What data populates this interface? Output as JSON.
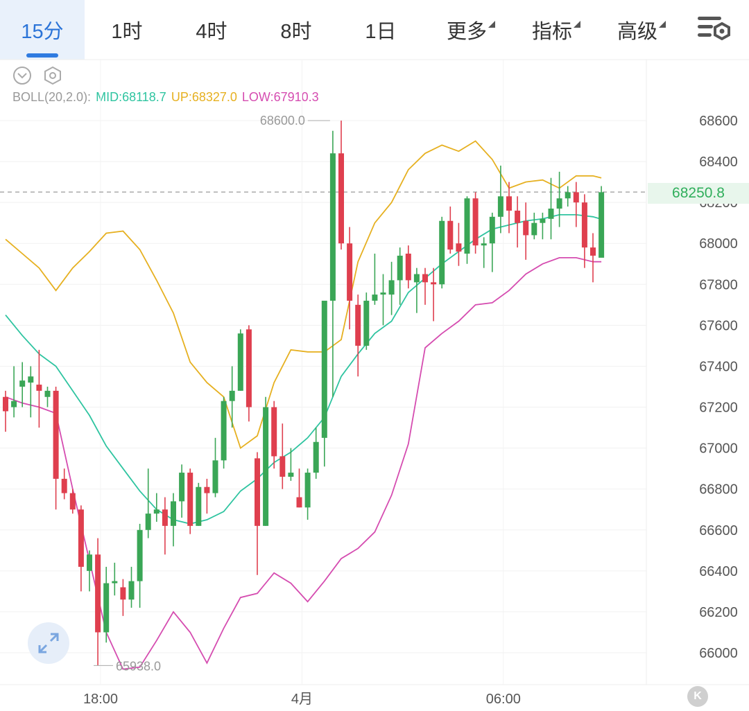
{
  "tabs": [
    {
      "label": "15分",
      "active": true
    },
    {
      "label": "1时"
    },
    {
      "label": "4时"
    },
    {
      "label": "8时"
    },
    {
      "label": "1日"
    },
    {
      "label": "更多",
      "dropdown": true
    },
    {
      "label": "指标",
      "dropdown": true
    },
    {
      "label": "高级",
      "dropdown": true
    }
  ],
  "icons": {
    "collapse": "chevron-down-circle-icon",
    "settings": "hexagon-settings-icon",
    "toolbar_settings": "lines-gear-icon",
    "expand": "expand-arrows-icon"
  },
  "indicator": {
    "name": "BOLL(20,2.0):",
    "mid": "MID:68118.7",
    "up": "UP:68327.0",
    "low": "LOW:67910.3",
    "colors": {
      "mid": "#2ec4a0",
      "up": "#e6b020",
      "low": "#d54cb0"
    }
  },
  "colors": {
    "up_candle": "#3aa656",
    "down_candle": "#df3f4e",
    "accent": "#2b74d8"
  },
  "price_tag": "68250.8",
  "k_button": "K",
  "chart_data": {
    "type": "candlestick",
    "y_ticks": [
      "68600",
      "68400",
      "68200",
      "68000",
      "67800",
      "67600",
      "67400",
      "67200",
      "67000",
      "66800",
      "66600",
      "66400",
      "66200",
      "66000"
    ],
    "ylim": [
      65870,
      68720
    ],
    "x_ticks": [
      {
        "label": "18:00",
        "i": 10
      },
      {
        "label": "4月",
        "i": 34
      },
      {
        "label": "06:00",
        "i": 58
      }
    ],
    "grid": true,
    "current_price": 68250.8,
    "high_label": {
      "text": "68600.0",
      "value": 68600,
      "i": 39
    },
    "low_label": {
      "text": "65938.0",
      "value": 65938,
      "i": 10
    },
    "candles": [
      [
        67250,
        67280,
        67080,
        67180
      ],
      [
        67200,
        67400,
        67150,
        67230
      ],
      [
        67300,
        67420,
        67200,
        67330
      ],
      [
        67320,
        67400,
        67150,
        67350
      ],
      [
        67310,
        67480,
        67100,
        67280
      ],
      [
        67250,
        67300,
        67200,
        67280
      ],
      [
        67280,
        67300,
        66700,
        66850
      ],
      [
        66850,
        66900,
        66750,
        66780
      ],
      [
        66780,
        66800,
        66680,
        66700
      ],
      [
        66700,
        66720,
        66300,
        66420
      ],
      [
        66400,
        66500,
        66300,
        66480
      ],
      [
        66480,
        66560,
        65938,
        66100
      ],
      [
        66100,
        66420,
        66050,
        66340
      ],
      [
        66340,
        66440,
        66280,
        66350
      ],
      [
        66320,
        66360,
        66180,
        66260
      ],
      [
        66260,
        66420,
        66220,
        66350
      ],
      [
        66350,
        66630,
        66220,
        66600
      ],
      [
        66600,
        66900,
        66560,
        66680
      ],
      [
        66680,
        66780,
        66640,
        66700
      ],
      [
        66700,
        66760,
        66480,
        66620
      ],
      [
        66620,
        66780,
        66520,
        66740
      ],
      [
        66740,
        66920,
        66660,
        66880
      ],
      [
        66880,
        66900,
        66580,
        66620
      ],
      [
        66620,
        66830,
        66620,
        66810
      ],
      [
        66810,
        66850,
        66680,
        66780
      ],
      [
        66780,
        67050,
        66760,
        66940
      ],
      [
        66940,
        67250,
        66900,
        67230
      ],
      [
        67230,
        67400,
        67100,
        67280
      ],
      [
        67280,
        67580,
        67280,
        67560
      ],
      [
        67580,
        67600,
        67130,
        67200
      ],
      [
        66950,
        66980,
        66380,
        66620
      ],
      [
        66620,
        67250,
        66620,
        67200
      ],
      [
        67200,
        67230,
        66900,
        66960
      ],
      [
        66960,
        67120,
        66800,
        66860
      ],
      [
        66860,
        67000,
        66840,
        66880
      ],
      [
        66760,
        66900,
        66710,
        66710
      ],
      [
        66710,
        66900,
        66650,
        66880
      ],
      [
        66880,
        67100,
        66850,
        67030
      ],
      [
        67050,
        67620,
        66910,
        67720
      ],
      [
        67720,
        68550,
        67250,
        68440
      ],
      [
        68440,
        68600,
        67970,
        68000
      ],
      [
        68000,
        68080,
        67580,
        67720
      ],
      [
        67700,
        67750,
        67350,
        67500
      ],
      [
        67500,
        67760,
        67480,
        67720
      ],
      [
        67720,
        67950,
        67700,
        67750
      ],
      [
        67750,
        67850,
        67600,
        67760
      ],
      [
        67750,
        67910,
        67650,
        67820
      ],
      [
        67820,
        67980,
        67700,
        67940
      ],
      [
        67950,
        67990,
        67780,
        67820
      ],
      [
        67810,
        67880,
        67660,
        67850
      ],
      [
        67850,
        67880,
        67700,
        67810
      ],
      [
        67810,
        67880,
        67620,
        67800
      ],
      [
        67800,
        68130,
        67780,
        68110
      ],
      [
        68110,
        68180,
        67950,
        67970
      ],
      [
        68000,
        68100,
        67890,
        67960
      ],
      [
        67950,
        68230,
        67900,
        68220
      ],
      [
        68220,
        68250,
        67950,
        67990
      ],
      [
        67990,
        68030,
        67880,
        68000
      ],
      [
        68000,
        68150,
        67860,
        68130
      ],
      [
        68130,
        68380,
        68050,
        68230
      ],
      [
        68230,
        68300,
        68050,
        68160
      ],
      [
        68160,
        68230,
        67980,
        68100
      ],
      [
        68110,
        68200,
        67920,
        68040
      ],
      [
        68040,
        68150,
        68020,
        68100
      ],
      [
        68100,
        68150,
        68020,
        68120
      ],
      [
        68120,
        68320,
        68020,
        68170
      ],
      [
        68170,
        68350,
        68080,
        68220
      ],
      [
        68220,
        68280,
        68180,
        68250
      ],
      [
        68250,
        68300,
        68080,
        68200
      ],
      [
        68200,
        68240,
        67880,
        67980
      ],
      [
        67980,
        68050,
        67810,
        67940
      ],
      [
        67930,
        68280,
        67970,
        68250
      ]
    ],
    "boll": {
      "i": [
        0,
        2,
        4,
        6,
        8,
        10,
        12,
        14,
        16,
        18,
        20,
        22,
        24,
        26,
        28,
        30,
        32,
        34,
        36,
        38,
        40,
        42,
        44,
        46,
        48,
        50,
        52,
        54,
        56,
        58,
        60,
        62,
        64,
        66,
        68,
        70,
        71
      ],
      "up": [
        68020,
        67950,
        67880,
        67770,
        67880,
        67960,
        68050,
        68060,
        67970,
        67820,
        67660,
        67420,
        67320,
        67250,
        67000,
        67060,
        67320,
        67480,
        67470,
        67470,
        67530,
        67910,
        68100,
        68200,
        68360,
        68440,
        68480,
        68450,
        68500,
        68410,
        68270,
        68300,
        68310,
        68270,
        68330,
        68330,
        68320
      ],
      "mid": [
        67650,
        67550,
        67460,
        67400,
        67280,
        67160,
        67010,
        66900,
        66790,
        66700,
        66650,
        66630,
        66650,
        66690,
        66790,
        66850,
        66930,
        66980,
        67050,
        67150,
        67350,
        67460,
        67560,
        67620,
        67760,
        67830,
        67900,
        67960,
        68020,
        68070,
        68090,
        68110,
        68120,
        68140,
        68140,
        68130,
        68118.7
      ],
      "low": [
        67250,
        67220,
        67200,
        67170,
        66800,
        66450,
        66100,
        65920,
        65930,
        66060,
        66200,
        66100,
        65950,
        66120,
        66270,
        66290,
        66390,
        66340,
        66250,
        66350,
        66460,
        66510,
        66590,
        66770,
        67020,
        67490,
        67560,
        67620,
        67700,
        67710,
        67770,
        67850,
        67900,
        67930,
        67930,
        67910.3,
        67910.3
      ]
    }
  }
}
